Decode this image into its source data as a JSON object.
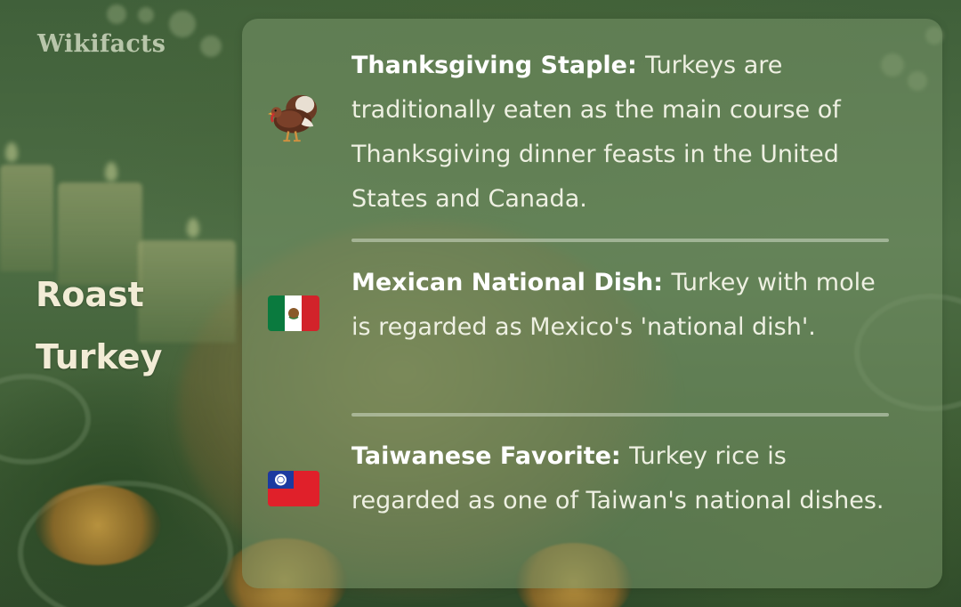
{
  "brand": "Wikifacts",
  "topic": {
    "line1": "Roast",
    "line2": "Turkey"
  },
  "facts": [
    {
      "icon": "turkey-icon",
      "heading": "Thanksgiving Staple:",
      "text": "Turkeys are traditionally eaten as the main course of Thanksgiving dinner feasts in the United States and Canada."
    },
    {
      "icon": "mexico-flag-icon",
      "heading": "Mexican National Dish:",
      "text": "Turkey with mole is regarded as Mexico's 'national dish'."
    },
    {
      "icon": "taiwan-flag-icon",
      "heading": "Taiwanese Favorite:",
      "text": "Turkey rice is regarded as one of Taiwan's national dishes."
    }
  ],
  "colors": {
    "card": "#7a9669",
    "title": "#f2ecd6",
    "text": "#eef0e2"
  }
}
